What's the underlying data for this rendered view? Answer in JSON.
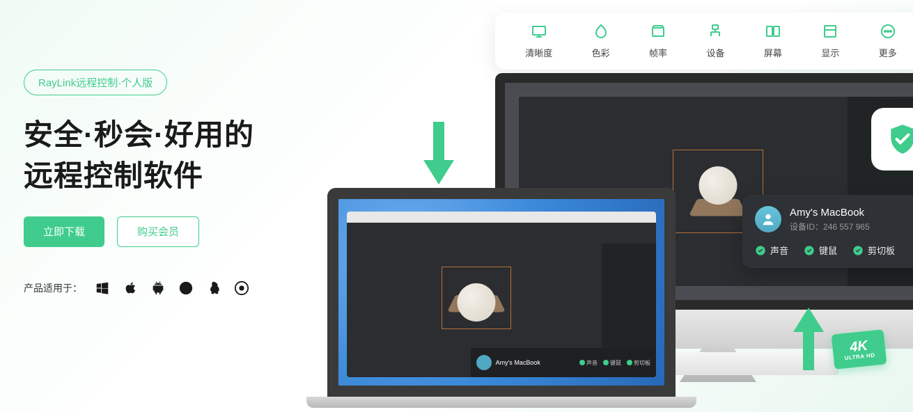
{
  "tag": "RayLink远程控制·个人版",
  "hero1": "安全·秒会·好用的",
  "hero2": "远程控制软件",
  "btn_primary": "立即下载",
  "btn_outline": "购买会员",
  "platform_label": "产品适用于：",
  "toolbar": [
    {
      "label": "清晰度"
    },
    {
      "label": "色彩"
    },
    {
      "label": "帧率"
    },
    {
      "label": "设备"
    },
    {
      "label": "屏幕"
    },
    {
      "label": "显示"
    },
    {
      "label": "更多"
    }
  ],
  "status": {
    "name": "Amy's MacBook",
    "id_label": "设备ID：",
    "id": "246 557 965",
    "chips": [
      "声音",
      "键鼠",
      "剪切板"
    ]
  },
  "laptop_status": {
    "name": "Amy's MacBook",
    "chips": [
      "声音",
      "键鼠",
      "剪切板"
    ]
  },
  "badge4k": {
    "top": "4K",
    "sub": "ULTRA HD"
  }
}
